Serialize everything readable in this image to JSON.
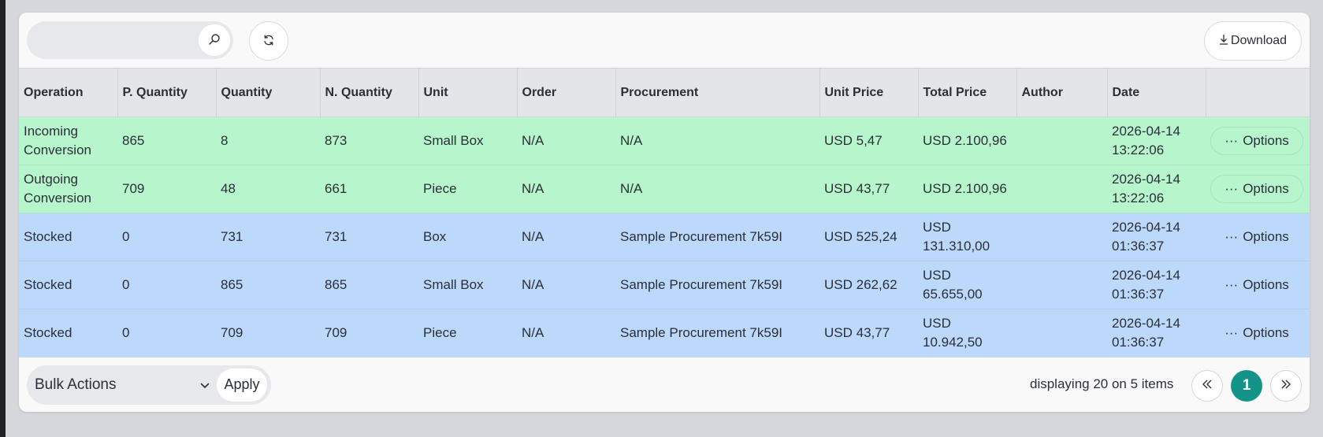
{
  "toolbar": {
    "search_placeholder": "",
    "search_icon": "search-icon",
    "refresh_icon": "refresh-icon",
    "download_label": "Download",
    "download_icon": "download-icon"
  },
  "table": {
    "headers": [
      "Operation",
      "P. Quantity",
      "Quantity",
      "N. Quantity",
      "Unit",
      "Order",
      "Procurement",
      "Unit Price",
      "Total Price",
      "Author",
      "Date",
      ""
    ],
    "rows": [
      {
        "operation": "Incoming Conversion",
        "p_quantity": "865",
        "quantity": "8",
        "n_quantity": "873",
        "unit": "Small Box",
        "order": "N/A",
        "procurement": "N/A",
        "unit_price": "USD 5,47",
        "total_price": "USD 2.100,96",
        "author": "",
        "date": "2026-04-14 13:22:06",
        "options": "Options"
      },
      {
        "operation": "Outgoing Conversion",
        "p_quantity": "709",
        "quantity": "48",
        "n_quantity": "661",
        "unit": "Piece",
        "order": "N/A",
        "procurement": "N/A",
        "unit_price": "USD 43,77",
        "total_price": "USD 2.100,96",
        "author": "",
        "date": "2026-04-14 13:22:06",
        "options": "Options"
      },
      {
        "operation": "Stocked",
        "p_quantity": "0",
        "quantity": "731",
        "n_quantity": "731",
        "unit": "Box",
        "order": "N/A",
        "procurement": "Sample Procurement 7k59I",
        "unit_price": "USD 525,24",
        "total_price": "USD 131.310,00",
        "author": "",
        "date": "2026-04-14 01:36:37",
        "options": "Options"
      },
      {
        "operation": "Stocked",
        "p_quantity": "0",
        "quantity": "865",
        "n_quantity": "865",
        "unit": "Small Box",
        "order": "N/A",
        "procurement": "Sample Procurement 7k59I",
        "unit_price": "USD 262,62",
        "total_price": "USD 65.655,00",
        "author": "",
        "date": "2026-04-14 01:36:37",
        "options": "Options"
      },
      {
        "operation": "Stocked",
        "p_quantity": "0",
        "quantity": "709",
        "n_quantity": "709",
        "unit": "Piece",
        "order": "N/A",
        "procurement": "Sample Procurement 7k59I",
        "unit_price": "USD 43,77",
        "total_price": "USD 10.942,50",
        "author": "",
        "date": "2026-04-14 01:36:37",
        "options": "Options"
      }
    ]
  },
  "footer": {
    "bulk_actions_label": "Bulk Actions",
    "apply_label": "Apply",
    "pagination_text": "displaying 20 on 5 items",
    "current_page": "1"
  },
  "colors": {
    "incoming_row": "#b7f5cd",
    "stocked_row": "#bcd8fb",
    "accent": "#149488"
  }
}
